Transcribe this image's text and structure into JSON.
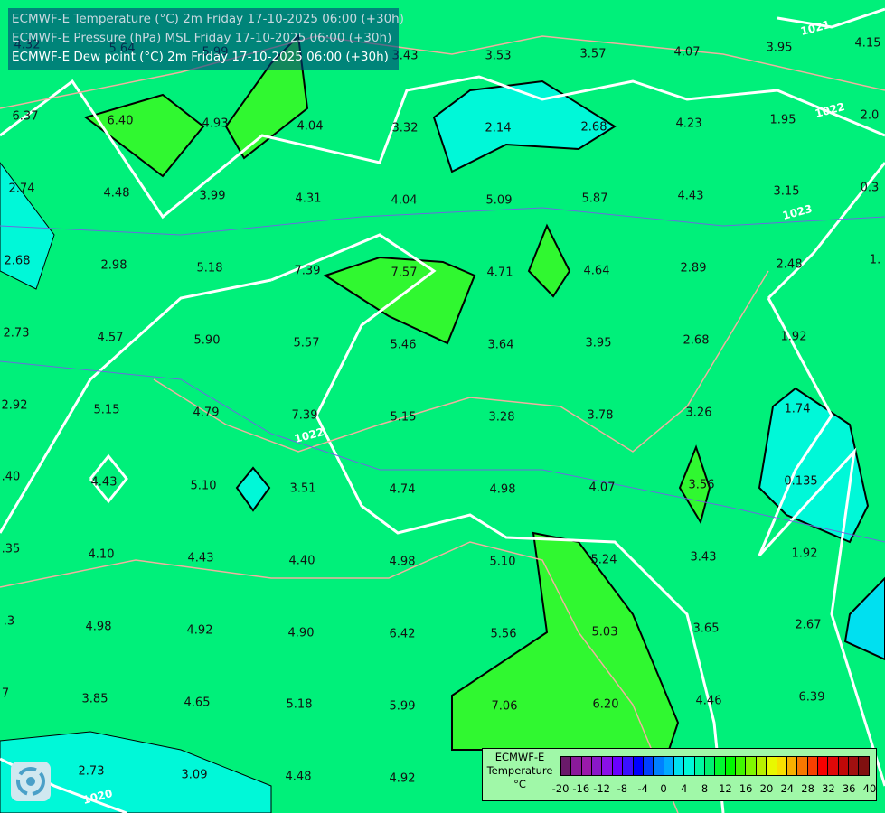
{
  "title_lines": [
    "ECMWF-E Temperature (°C) 2m Friday 17-10-2025 06:00 (+30h)",
    "ECMWF-E Pressure (hPa) MSL Friday 17-10-2025 06:00 (+30h)",
    "ECMWF-E Dew point (°C) 2m Friday 17-10-2025 06:00 (+30h)"
  ],
  "legend": {
    "title": [
      "ECMWF-E",
      "Temperature",
      "°C"
    ],
    "ticks": [
      "-20",
      "-16",
      "-12",
      "-8",
      "-4",
      "0",
      "4",
      "8",
      "12",
      "16",
      "20",
      "24",
      "28",
      "32",
      "36",
      "40"
    ],
    "colors": [
      "#6a1a6a",
      "#8a1a9a",
      "#9a1aaa",
      "#8a18c8",
      "#8a10e8",
      "#6a00ff",
      "#3a10ff",
      "#0000ff",
      "#0040ff",
      "#0080ff",
      "#00aaff",
      "#00e0f0",
      "#00f8d8",
      "#00f8a0",
      "#00f070",
      "#00f830",
      "#00f800",
      "#40f800",
      "#80f800",
      "#b8f000",
      "#e8f800",
      "#f8e000",
      "#f8b000",
      "#f87800",
      "#f84000",
      "#f80000",
      "#e00808",
      "#c00808",
      "#a01010",
      "#801010",
      "#601010"
    ]
  },
  "isobars": [
    "1021",
    "1022",
    "1023",
    "1022",
    "1020"
  ],
  "values": [
    "4.32",
    "5.64",
    "5.99",
    "3.43",
    "3.53",
    "3.57",
    "4.07",
    "3.95",
    "4.15",
    "6.37",
    "6.40",
    "4.93",
    "4.04",
    "3.32",
    "2.14",
    "2.68",
    "4.23",
    "1.95",
    "2.0",
    "2.74",
    "4.48",
    "3.99",
    "4.31",
    "4.04",
    "5.09",
    "5.87",
    "4.43",
    "3.15",
    "0.3",
    "2.68",
    "2.98",
    "5.18",
    "7.39",
    "7.57",
    "4.71",
    "4.64",
    "2.89",
    "2.48",
    "1.",
    "2.73",
    "4.57",
    "5.90",
    "5.57",
    "5.46",
    "3.64",
    "3.95",
    "2.68",
    "1.92",
    "2.92",
    "5.15",
    "4.79",
    "7.39",
    "5.15",
    "3.28",
    "3.78",
    "3.26",
    "1.74",
    ".40",
    "4.43",
    "5.10",
    "3.51",
    "4.74",
    "4.98",
    "4.07",
    "3.56",
    "0.135",
    ".35",
    "4.10",
    "4.43",
    "4.40",
    "4.98",
    "5.10",
    "5.24",
    "3.43",
    "1.92",
    ".3",
    "4.98",
    "4.92",
    "4.90",
    "6.42",
    "5.56",
    "5.03",
    "3.65",
    "2.67",
    "7",
    "3.85",
    "4.65",
    "5.18",
    "5.99",
    "7.06",
    "6.20",
    "4.46",
    "6.39",
    "2.73",
    "3.09",
    "4.48",
    "4.92"
  ]
}
